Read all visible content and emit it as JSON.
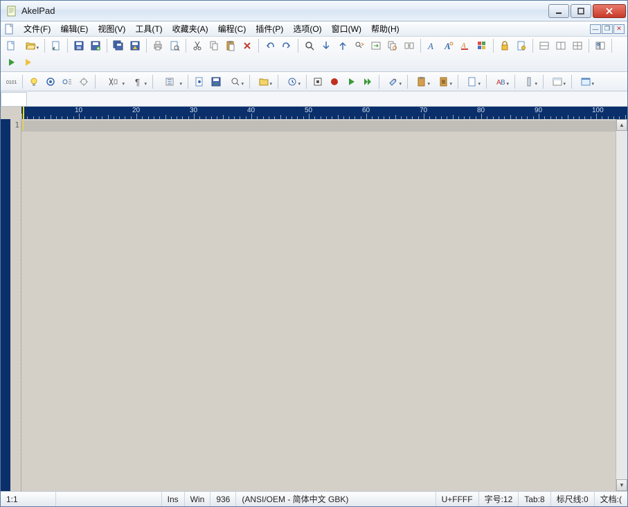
{
  "title": "AkelPad",
  "menu": {
    "file": "文件(F)",
    "edit": "编辑(E)",
    "view": "视图(V)",
    "tools": "工具(T)",
    "favorites": "收藏夹(A)",
    "programming": "编程(C)",
    "plugins": "插件(P)",
    "options": "选项(O)",
    "window": "窗口(W)",
    "help": "帮助(H)"
  },
  "tab": {
    "label": " "
  },
  "ruler": {
    "labels": [
      "10",
      "20",
      "30",
      "40",
      "50",
      "60",
      "70",
      "80",
      "90",
      "100"
    ]
  },
  "lines": {
    "first": "1"
  },
  "status": {
    "pos": "1:1",
    "ins": "Ins",
    "win": "Win",
    "cp": "936",
    "encoding": "(ANSI/OEM - 简体中文 GBK)",
    "unicode": "U+FFFF",
    "fontsize": "字号:12",
    "tab": "Tab:8",
    "ruler": "标尺线:0",
    "doc": "文档:("
  }
}
